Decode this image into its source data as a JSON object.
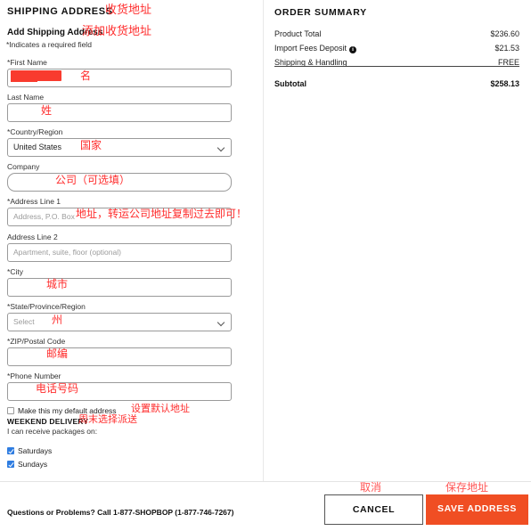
{
  "shipping": {
    "heading": "SHIPPING ADDRESS",
    "heading_annotation": "收货地址",
    "subheading": "Add Shipping Address",
    "subheading_annotation": "添加收货地址",
    "required_note": "*Indicates a required field",
    "fields": [
      {
        "label": "First Name",
        "required": true,
        "type": "text",
        "value": "",
        "placeholder": "",
        "redacted": true,
        "annotation": "名"
      },
      {
        "label": "Last Name",
        "required": false,
        "type": "text",
        "value": "",
        "placeholder": "",
        "annotation": "姓"
      },
      {
        "label": "Country/Region",
        "required": true,
        "type": "select",
        "value": "United States",
        "placeholder": "",
        "annotation": "国家"
      },
      {
        "label": "Company",
        "required": false,
        "type": "text",
        "value": "",
        "placeholder": "",
        "annotation": "公司（可选填）"
      },
      {
        "label": "Address Line 1",
        "required": true,
        "type": "text",
        "value": "",
        "placeholder": "Address, P.O. Box",
        "annotation": "地址，转运公司地址复制过去即可！"
      },
      {
        "label": "Address Line 2",
        "required": false,
        "type": "text",
        "value": "",
        "placeholder": "Apartment, suite, floor (optional)",
        "annotation": ""
      },
      {
        "label": "City",
        "required": true,
        "type": "text",
        "value": "",
        "placeholder": "",
        "annotation": "城市"
      },
      {
        "label": "State/Province/Region",
        "required": true,
        "type": "select",
        "value": "Select",
        "placeholder": "",
        "annotation": "州"
      },
      {
        "label": "ZIP/Postal Code",
        "required": true,
        "type": "text",
        "value": "",
        "placeholder": "",
        "annotation": "邮编"
      },
      {
        "label": "Phone Number",
        "required": true,
        "type": "text",
        "value": "",
        "placeholder": "",
        "annotation": "电话号码"
      }
    ],
    "default_address": {
      "label": "Make this my default address",
      "checked": false,
      "annotation": "设置默认地址"
    },
    "weekend": {
      "title": "WEEKEND DELIVERY",
      "annotation": "周末选择派送",
      "subtitle": "I can receive packages on:",
      "options": [
        {
          "label": "Saturdays",
          "checked": true
        },
        {
          "label": "Sundays",
          "checked": true
        }
      ]
    }
  },
  "order_summary": {
    "heading": "ORDER SUMMARY",
    "rows": [
      {
        "label": "Product Total",
        "value": "$236.60",
        "info": false
      },
      {
        "label": "Import Fees Deposit",
        "value": "$21.53",
        "info": true
      },
      {
        "label": "Shipping & Handling",
        "value": "FREE",
        "info": false
      }
    ],
    "total": {
      "label": "Subtotal",
      "value": "$258.13"
    }
  },
  "footer": {
    "help_text": "Questions or Problems? Call 1-877-SHOPBOP (1-877-746-7267)",
    "cancel_label": "CANCEL",
    "cancel_annotation": "取消",
    "save_label": "SAVE ADDRESS",
    "save_annotation": "保存地址"
  },
  "colors": {
    "accent": "#f04e23",
    "annotation_red": "#ff2d2d",
    "checkbox_blue": "#2f7de1",
    "redaction_red": "#f93b2e"
  }
}
